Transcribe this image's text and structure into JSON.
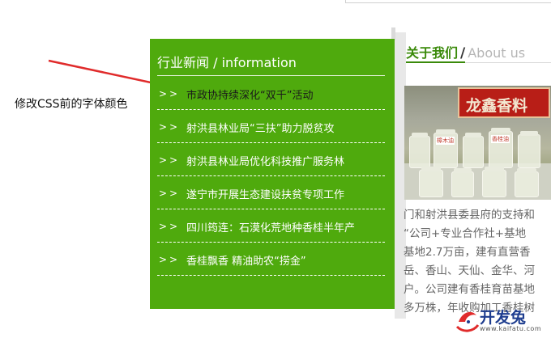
{
  "annotation": {
    "label": "修改CSS前的字体颜色"
  },
  "news": {
    "heading": "行业新闻 / information",
    "bullet": ">>",
    "items": [
      {
        "title": "市政协持续深化“双千”活动"
      },
      {
        "title": "射洪县林业局“三扶”助力脱贫攻"
      },
      {
        "title": "射洪县林业局优化科技推广服务林"
      },
      {
        "title": "遂宁市开展生态建设扶贫专项工作"
      },
      {
        "title": "四川筠连：石漠化荒地种香桂半年产"
      },
      {
        "title": "香桂飘香 精油助农“捞金”"
      }
    ]
  },
  "about": {
    "title_cn": "关于我们",
    "separator": "/",
    "title_en": "About us",
    "photo": {
      "sign_text": "龙鑫香料",
      "jar_labels": [
        "樟木油",
        "香桂油"
      ]
    },
    "text_lines": [
      "门和射洪县委县府的支持和",
      "“公司+专业合作社+基地",
      "基地2.7万亩，建有直营香",
      "岳、香山、天仙、金华、河",
      "户。公司建有香桂育苗基地",
      "多万株，年收购加工香桂树"
    ]
  },
  "watermark": {
    "title": "开发兔",
    "url": "www.kaifatu.com"
  },
  "colors": {
    "panel_green": "#4faa0d",
    "about_green": "#3a8a0a",
    "arrow_red": "#e02b2b",
    "first_item_text": "#1a1a1a",
    "item_text": "#ffffff"
  }
}
